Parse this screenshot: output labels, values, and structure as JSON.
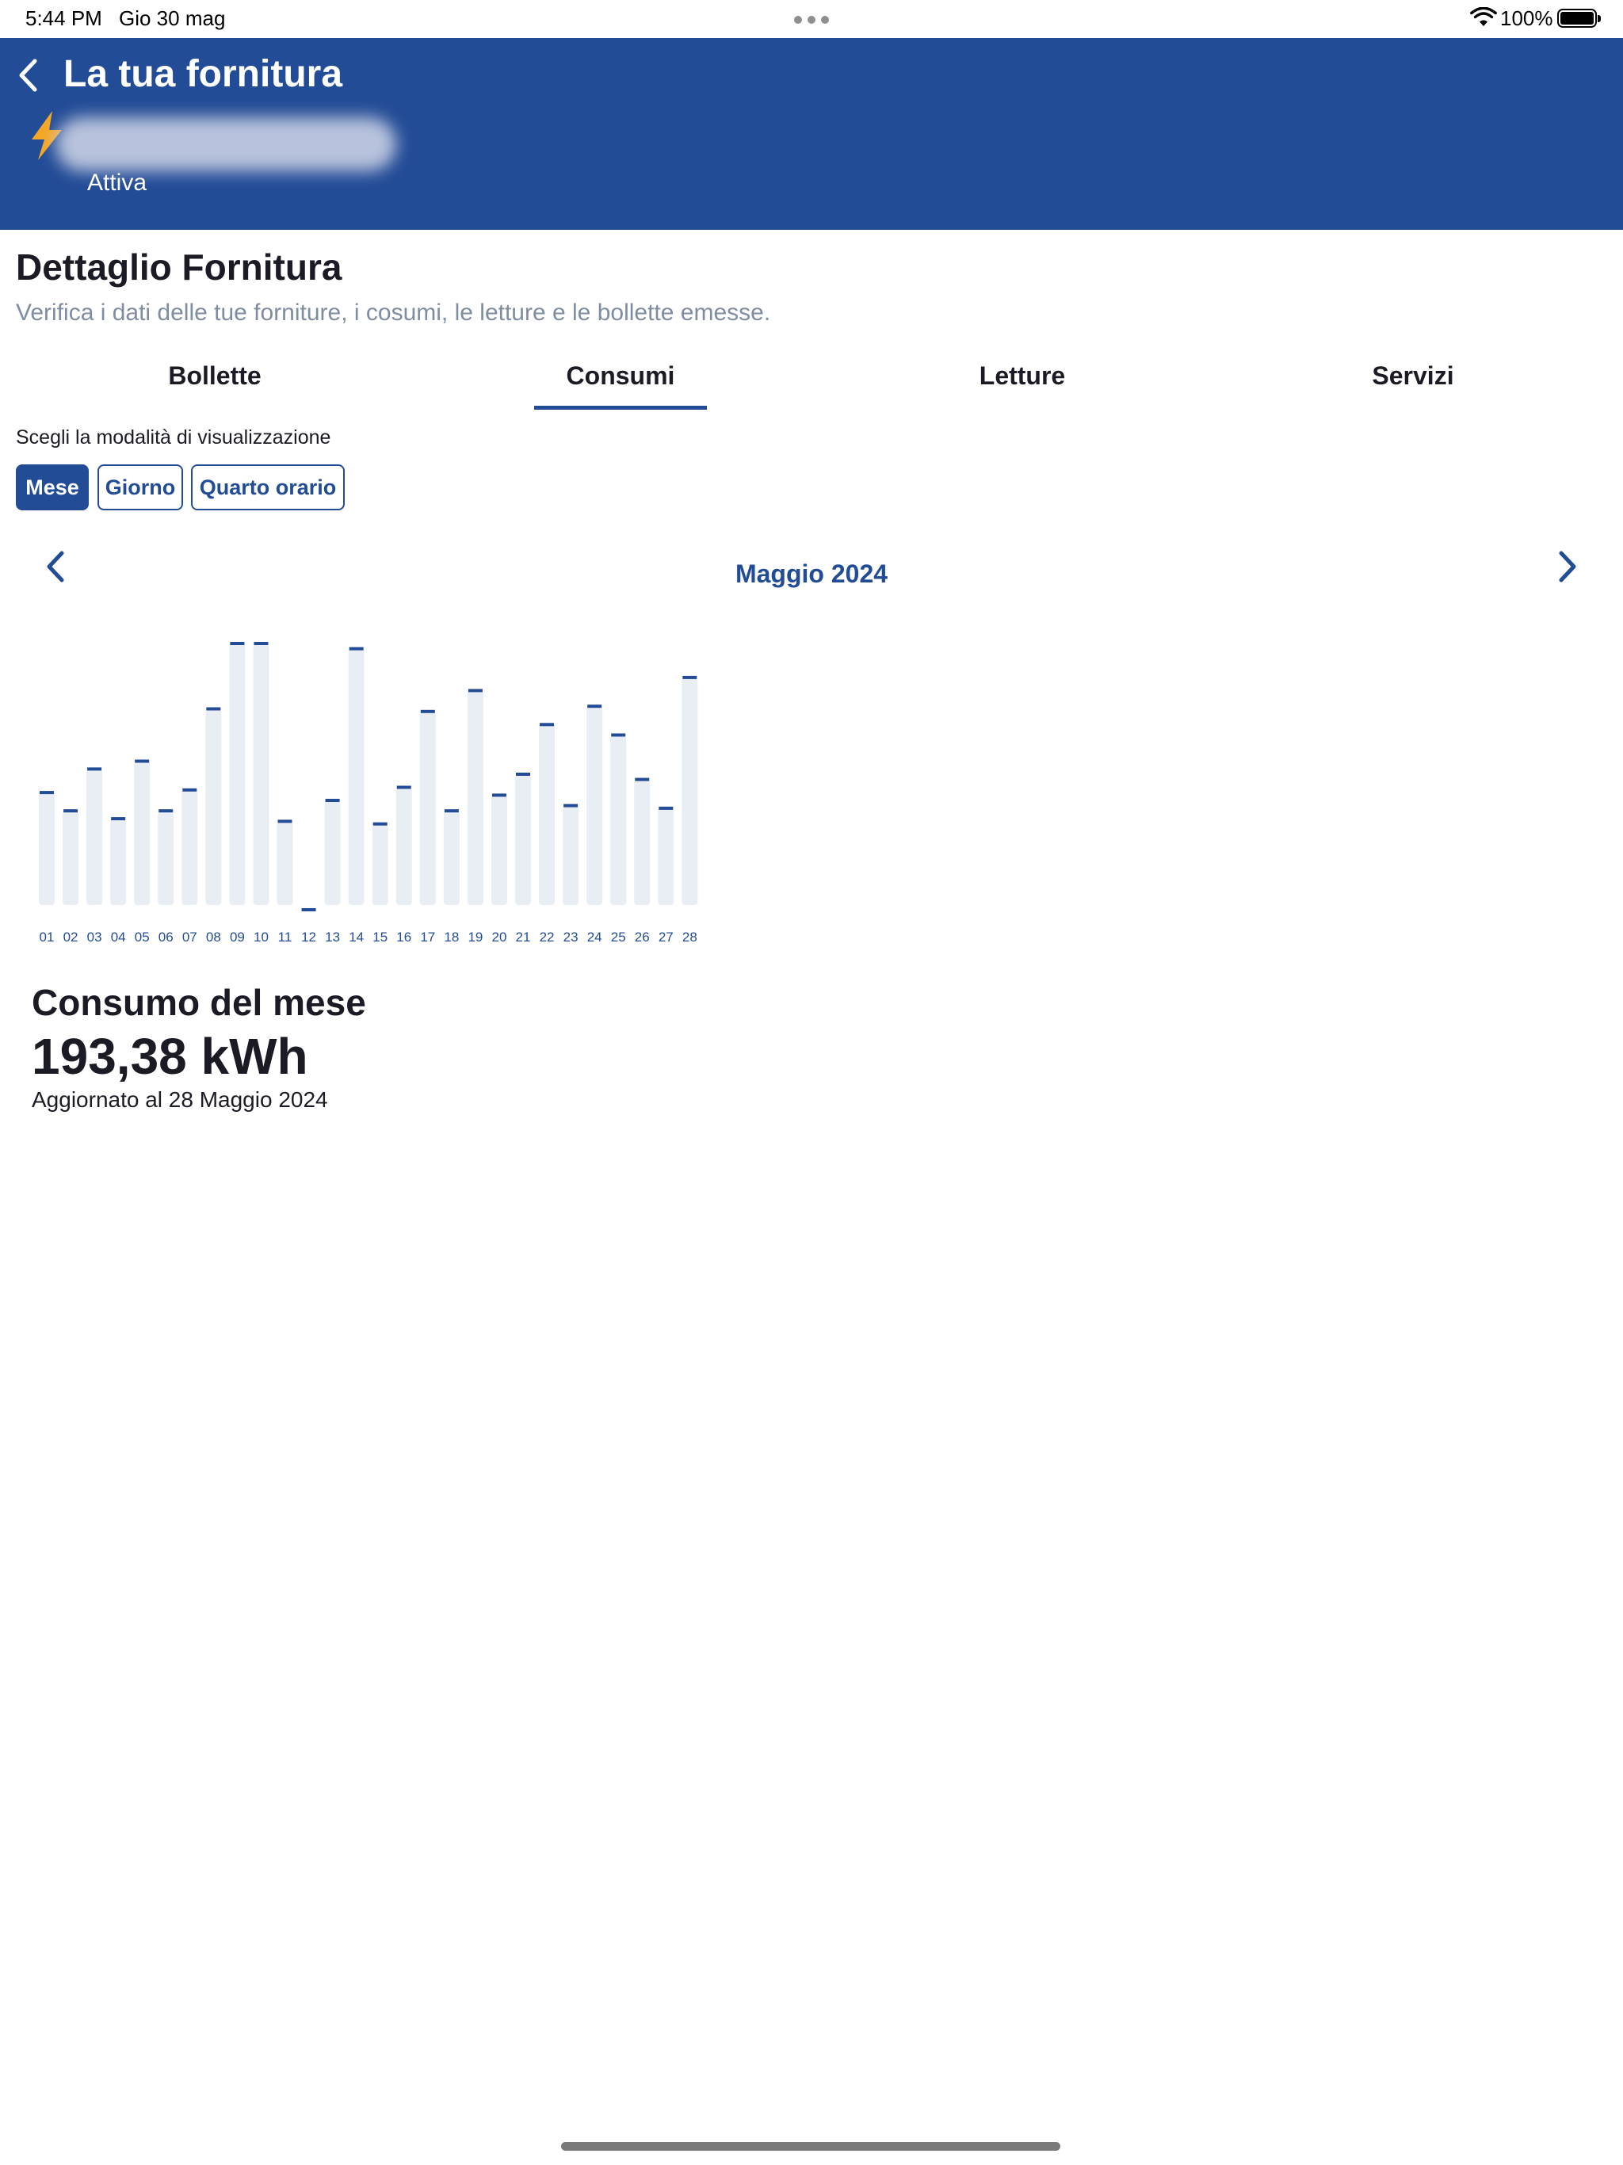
{
  "status_bar": {
    "time": "5:44 PM",
    "date": "Gio 30 mag",
    "battery_percent": "100%"
  },
  "header": {
    "title": "La tua fornitura",
    "supply_status": "Attiva",
    "icons": {
      "back": "chevron-left-icon",
      "supply": "lightning-bolt-icon"
    },
    "colors": {
      "background": "#234c96",
      "bolt": "#f5a623"
    }
  },
  "detail": {
    "title": "Dettaglio Fornitura",
    "subtitle": "Verifica i dati delle tue forniture, i cosumi, le letture e le bollette emesse."
  },
  "tabs": [
    {
      "label": "Bollette",
      "active": false
    },
    {
      "label": "Consumi",
      "active": true
    },
    {
      "label": "Letture",
      "active": false
    },
    {
      "label": "Servizi",
      "active": false
    }
  ],
  "view_mode": {
    "label": "Scegli la modalità di visualizzazione",
    "options": [
      {
        "label": "Mese",
        "active": true
      },
      {
        "label": "Giorno",
        "active": false
      },
      {
        "label": "Quarto orario",
        "active": false
      }
    ]
  },
  "period": {
    "label": "Maggio 2024",
    "icons": {
      "prev": "chevron-left-icon",
      "next": "chevron-right-icon"
    }
  },
  "chart_data": {
    "type": "bar",
    "title": "",
    "xlabel": "",
    "ylabel": "",
    "categories": [
      "01",
      "02",
      "03",
      "04",
      "05",
      "06",
      "07",
      "08",
      "09",
      "10",
      "11",
      "12",
      "13",
      "14",
      "15",
      "16",
      "17",
      "18",
      "19",
      "20",
      "21",
      "22",
      "23",
      "24",
      "25",
      "26",
      "27",
      "28"
    ],
    "values": [
      0.43,
      0.36,
      0.52,
      0.33,
      0.55,
      0.36,
      0.44,
      0.75,
      1.0,
      1.0,
      0.32,
      0.0,
      0.4,
      0.98,
      0.31,
      0.45,
      0.74,
      0.36,
      0.82,
      0.42,
      0.5,
      0.69,
      0.38,
      0.76,
      0.65,
      0.48,
      0.37,
      0.87
    ],
    "value_unit": "fraction of chart maximum (no axis scale shown)",
    "ylim": [
      0,
      1
    ],
    "grid": false,
    "legend": "none",
    "colors": {
      "bar_track": "#e9edf4",
      "bar_marker": "#234c96",
      "tick_label": "#234c96"
    }
  },
  "summary": {
    "title": "Consumo del mese",
    "value": "193,38 kWh",
    "updated": "Aggiornato al 28 Maggio 2024"
  }
}
